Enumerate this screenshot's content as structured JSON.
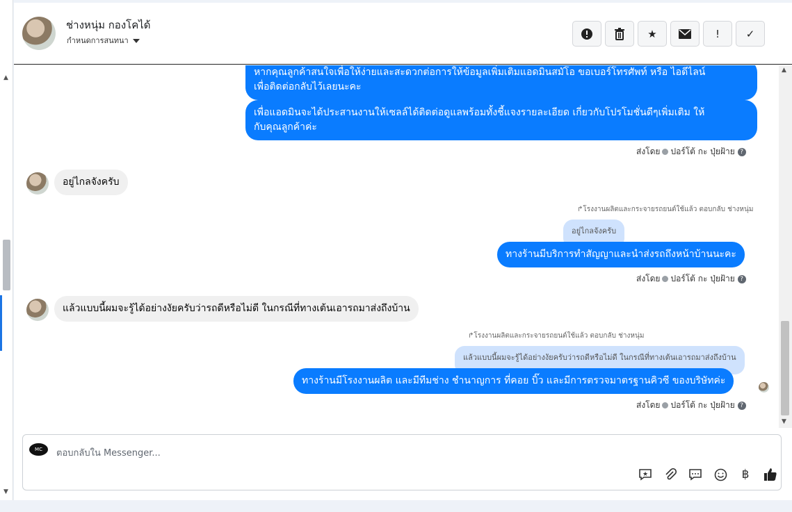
{
  "header": {
    "contact_name": "ช่างหนุ่ม กองโคได้",
    "assign_label": "กำหนดการสนทนา",
    "tools": [
      {
        "icon": "alert-circle-icon",
        "glyph": "!"
      },
      {
        "icon": "trash-icon",
        "glyph": "🗑"
      },
      {
        "icon": "star-icon",
        "glyph": "★"
      },
      {
        "icon": "envelope-icon",
        "glyph": "✉"
      },
      {
        "icon": "exclamation-icon",
        "glyph": "!"
      },
      {
        "icon": "check-icon",
        "glyph": "✓"
      }
    ]
  },
  "messages": {
    "m1": "หากคุณลูกค้าสนใจเพื่อให้ง่ายและสะดวกต่อการให้ข้อมูลเพิ่มเติมแอดมินสมัโอ ขอเบอร์โทรศัพท์ หรือ ไอดีไลน์",
    "m1b": "เพื่อติดต่อกลับไว้เลยนะคะ",
    "m2": "เพื่อแอดมินจะได้ประสานงานให้เซลล์ได้ติดต่อดูแลพร้อมทั้งชี้แจงรายละเอียด เกี่ยวกับโปรโมชั่นดีๆเพิ่มเติม ให้",
    "m2b": "กับคุณลูกค้าค่ะ",
    "meta1": "ส่งโดย",
    "meta1_name": "ปอร์โต้ กะ ปุ่ยฝ้าย",
    "in1": "อยู่ไกลจังครับ",
    "reply_note1": "โรงงานผลิตและกระจายรถยนต์ใช้แล้ว ตอบกลับ ช่างหนุ่ม",
    "quote1": "อยู่ไกลจังครับ",
    "m3": "ทางร้านมีบริการทำสัญญาและนำส่งรถถึงหน้าบ้านนะคะ",
    "meta2": "ส่งโดย",
    "meta2_name": "ปอร์โต้ กะ ปุ่ยฝ้าย",
    "in2": "แล้วแบบนี้ผมจะรู้ได้อย่างงัยครับว่ารถดีหรือไม่ดี   ในกรณีที่ทางเต้นเอารถมาส่งถึงบ้าน",
    "reply_note2": "โรงงานผลิตและกระจายรถยนต์ใช้แล้ว ตอบกลับ ช่างหนุ่ม",
    "quote2": "แล้วแบบนี้ผมจะรู้ได้อย่างงัยครับว่ารถดีหรือไม่ดี ในกรณีที่ทางเต้นเอารถมาส่งถึงบ้าน",
    "m4": "ทางร้านมีโรงงานผลิต และมีทีมช่าง ชำนาญการ ที่คอย บิ๊ว และมีการตรวจมาตรฐานคิวซี ของบริษัทค่ะ",
    "meta3": "ส่งโดย",
    "meta3_name": "ปอร์โต้ กะ ปุ่ยฝ้าย"
  },
  "composer": {
    "placeholder": "ตอบกลับใน Messenger...",
    "icons": [
      {
        "icon": "saved-reply-icon",
        "glyph": "✱"
      },
      {
        "icon": "paperclip-icon",
        "glyph": "📎"
      },
      {
        "icon": "chat-bubble-icon",
        "glyph": "💬"
      },
      {
        "icon": "emoji-icon",
        "glyph": "☺"
      },
      {
        "icon": "baht-icon",
        "glyph": "฿"
      },
      {
        "icon": "like-icon",
        "glyph": "👍"
      }
    ]
  },
  "colors": {
    "outgoing": "#0a7cff",
    "incoming": "#f0f0f0",
    "quote": "#cfe2fd"
  }
}
